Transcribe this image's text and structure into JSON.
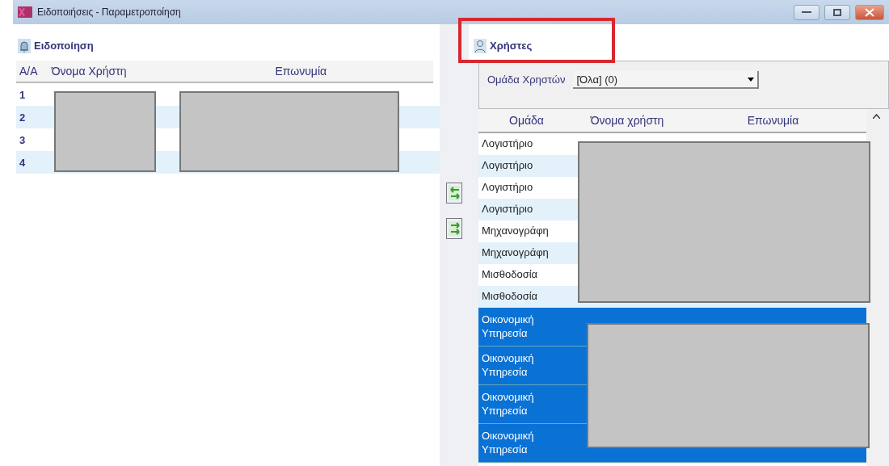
{
  "window": {
    "title": "Ειδοποιήσεις - Παραμετροποίηση"
  },
  "notification_panel": {
    "title": "Ειδοποίηση",
    "table": {
      "columns": [
        "Α/Α",
        "Όνομα Χρήστη",
        "Επωνυμία"
      ],
      "rows": [
        {
          "number": "1"
        },
        {
          "number": "2"
        },
        {
          "number": "3"
        },
        {
          "number": "4"
        }
      ]
    }
  },
  "users_panel": {
    "title": "Χρήστες",
    "highlighted": true,
    "user_group": {
      "label": "Ομάδα Χρηστών",
      "value": "[Όλα]  (0)"
    },
    "table": {
      "columns": [
        "Ομάδα",
        "Όνομα χρήστη",
        "Επωνυμία"
      ],
      "rows": [
        {
          "group": "Λογιστήριο",
          "selected": false
        },
        {
          "group": "Λογιστήριο",
          "selected": false
        },
        {
          "group": "Λογιστήριο",
          "selected": false
        },
        {
          "group": "Λογιστήριο",
          "selected": false
        },
        {
          "group": "Μηχανογράφη",
          "selected": false
        },
        {
          "group": "Μηχανογράφη",
          "selected": false
        },
        {
          "group": "Μισθοδοσία",
          "selected": false
        },
        {
          "group": "Μισθοδοσία",
          "selected": false
        },
        {
          "group": "Οικονομική Υπηρεσία",
          "selected": true
        },
        {
          "group": "Οικονομική Υπηρεσία",
          "selected": true
        },
        {
          "group": "Οικονομική Υπηρεσία",
          "selected": true
        },
        {
          "group": "Οικονομική Υπηρεσία",
          "selected": true
        }
      ]
    }
  }
}
